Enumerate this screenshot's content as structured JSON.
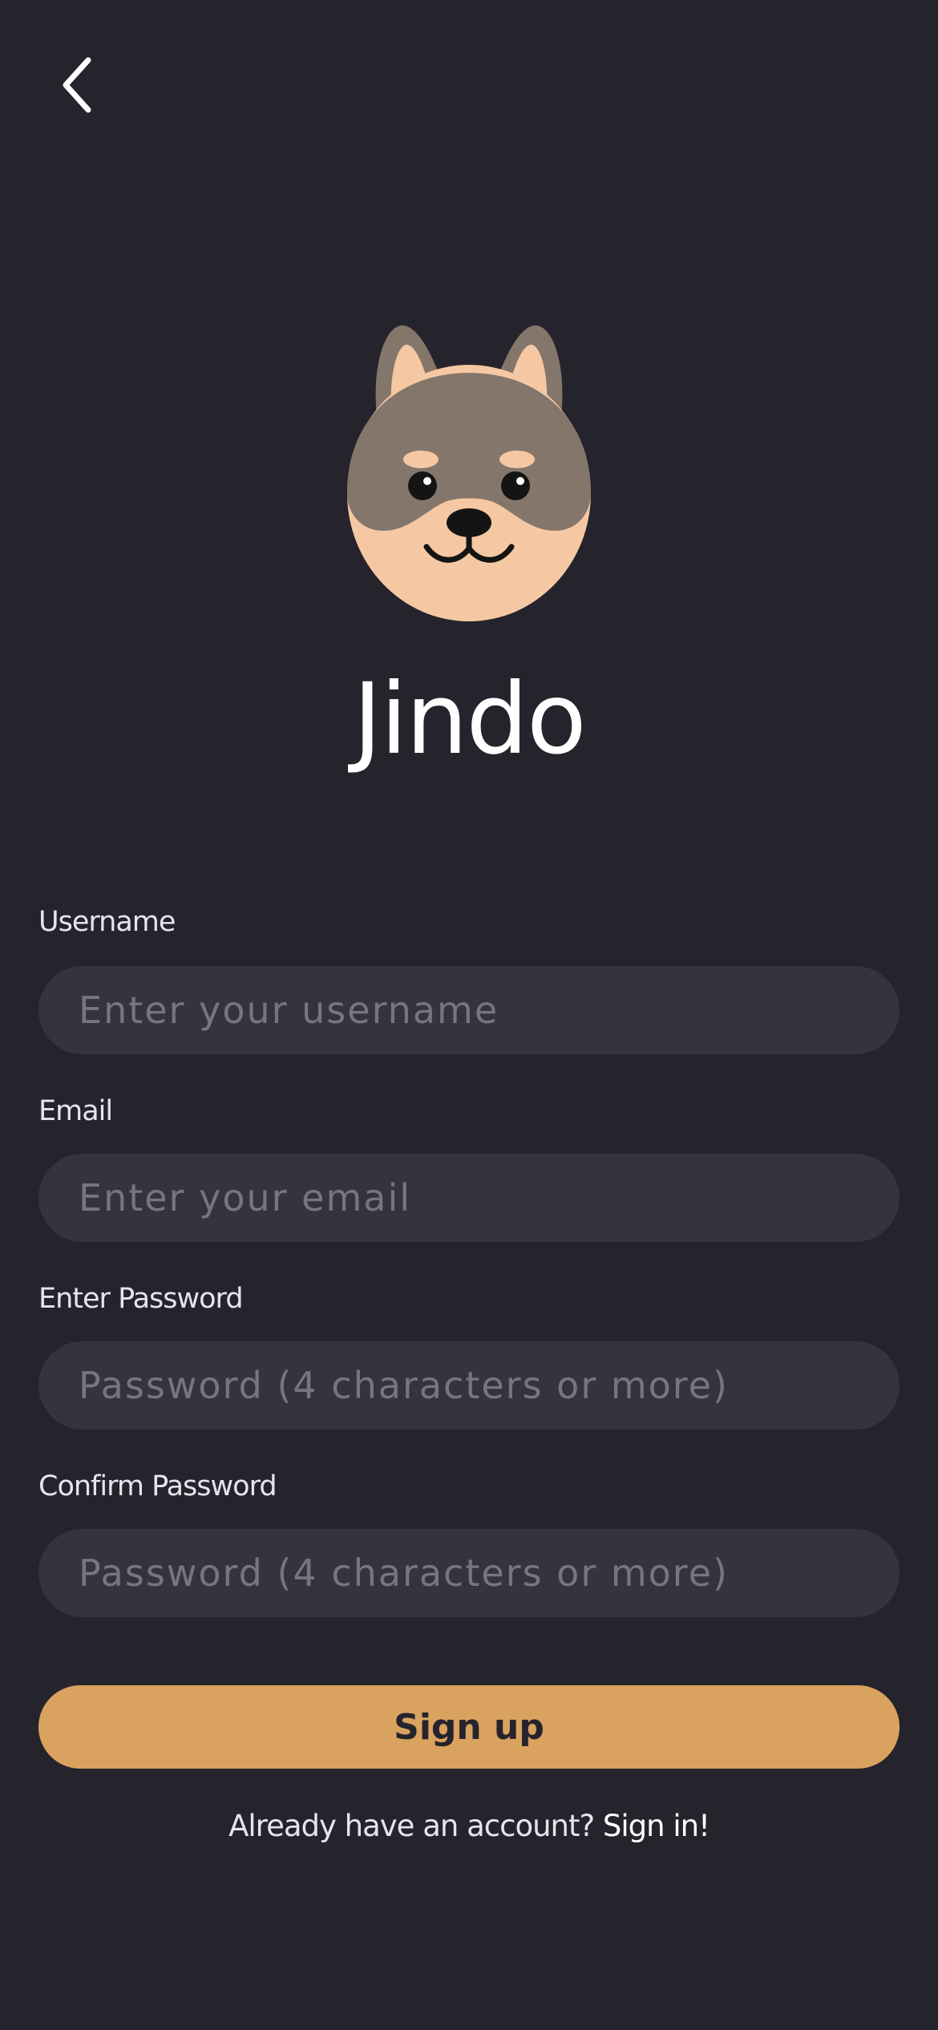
{
  "header": {
    "back_icon": "chevron-left-icon"
  },
  "brand": {
    "logo_icon": "dog-face-icon",
    "app_name": "Jindo"
  },
  "form": {
    "username": {
      "label": "Username",
      "value": "",
      "placeholder": "Enter your username"
    },
    "email": {
      "label": "Email",
      "value": "",
      "placeholder": "Enter your email"
    },
    "password": {
      "label": "Enter Password",
      "value": "",
      "placeholder": "Password (4 characters or more)"
    },
    "confirm_password": {
      "label": "Confirm Password",
      "value": "",
      "placeholder": "Password (4 characters or more)"
    },
    "submit_label": "Sign up"
  },
  "footer": {
    "prompt": "Already have an account?",
    "link_label": "Sign in!"
  },
  "colors": {
    "background": "#25242d",
    "input_background": "#34333f",
    "accent": "#daa25f",
    "dog_fur": "#85766b",
    "dog_cream": "#f5c8a3"
  }
}
